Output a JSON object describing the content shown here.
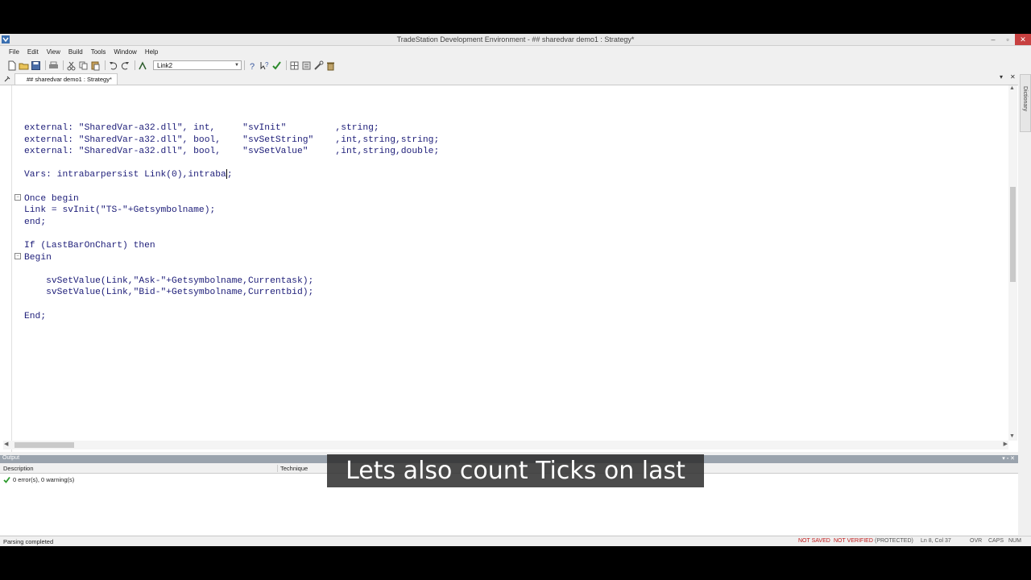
{
  "window": {
    "title": "TradeStation Development Environment - ## sharedvar demo1 : Strategy*",
    "controls": [
      "–",
      "▫",
      "✕"
    ]
  },
  "menu": {
    "items": [
      "File",
      "Edit",
      "View",
      "Build",
      "Tools",
      "Window",
      "Help"
    ]
  },
  "toolbar": {
    "analysis_combo_value": "Link2"
  },
  "editor": {
    "tab_label": "## sharedvar demo1 : Strategy*",
    "code_lines": [
      "external: \"SharedVar-a32.dll\", int,     \"svInit\"         ,string;",
      "external: \"SharedVar-a32.dll\", bool,    \"svSetString\"    ,int,string,string;",
      "external: \"SharedVar-a32.dll\", bool,    \"svSetValue\"     ,int,string,double;",
      "",
      "Vars: intrabarpersist Link(0),intraba",
      "",
      "Once begin",
      "Link = svInit(\"TS-\"+Getsymbolname);",
      "end;",
      "",
      "If (LastBarOnChart) then",
      "Begin",
      "",
      "    svSetValue(Link,\"Ask-\"+Getsymbolname,Currentask);",
      "    svSetValue(Link,\"Bid-\"+Getsymbolname,Currentbid);",
      "",
      "End;"
    ],
    "cursor_suffix": ";"
  },
  "dictionary_label": "Dictionary",
  "output": {
    "title": "Output",
    "columns": {
      "description": "Description",
      "technique": "Technique"
    },
    "rows": [
      {
        "text": "0 error(s), 0 warning(s)"
      }
    ]
  },
  "status": {
    "message": "Parsing completed",
    "not_saved": "NOT SAVED",
    "not_verified": "NOT VERIFIED",
    "protected": "(PROTECTED)",
    "position": "Ln 8, Col 37",
    "ovr": "OVR",
    "caps": "CAPS",
    "num": "NUM"
  },
  "caption": "Lets also count Ticks on last bar",
  "colors": {
    "code_text": "#1c1c78",
    "status_red": "#c01818",
    "close_button": "#c74040"
  }
}
